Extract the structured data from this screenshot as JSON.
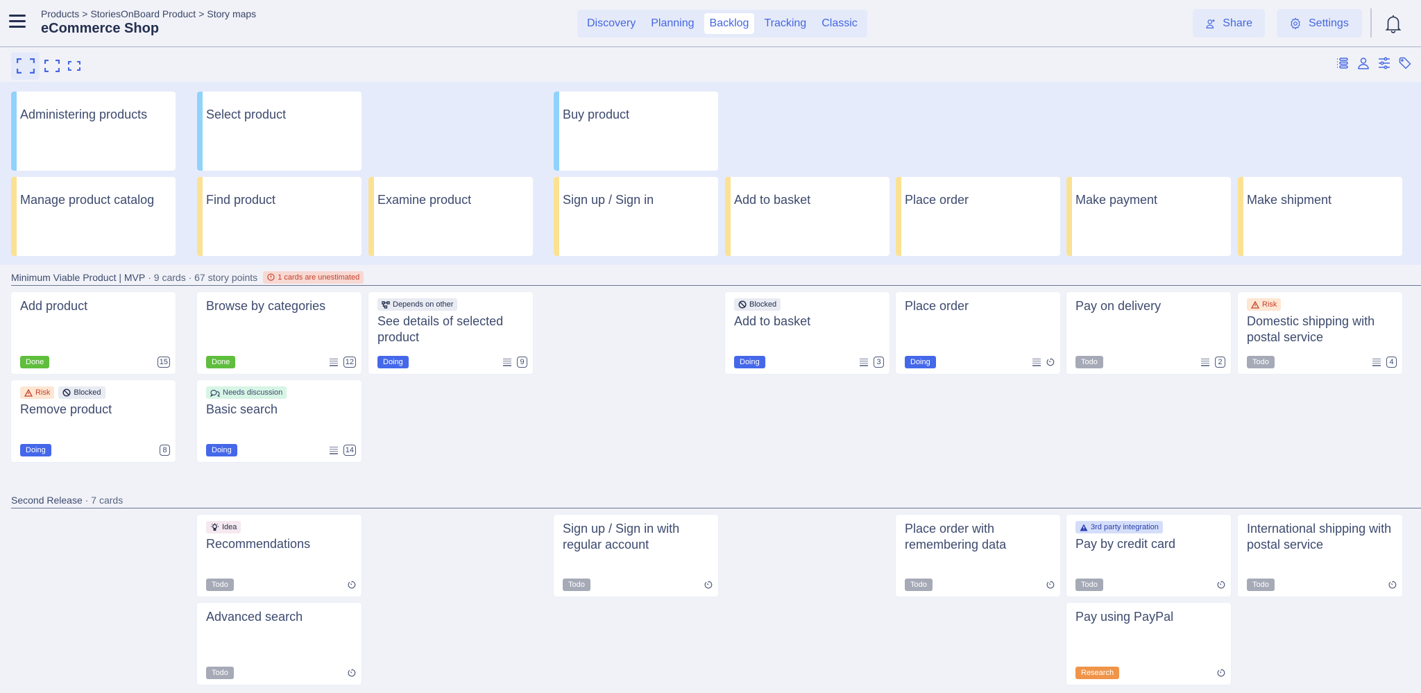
{
  "header": {
    "breadcrumb": [
      "Products",
      "StoriesOnBoard Product",
      "Story maps"
    ],
    "breadcrumb_separator": ">",
    "title": "eCommerce Shop",
    "view_tabs": [
      {
        "label": "Discovery",
        "active": false
      },
      {
        "label": "Planning",
        "active": false
      },
      {
        "label": "Backlog",
        "active": true
      },
      {
        "label": "Tracking",
        "active": false
      },
      {
        "label": "Classic",
        "active": false
      }
    ],
    "share_label": "Share",
    "settings_label": "Settings",
    "icons": {
      "menu": "hamburger-icon",
      "share": "user-plus-icon",
      "settings": "gear-icon",
      "notifications": "bell-icon"
    }
  },
  "toolbar": {
    "zoom_levels": [
      "large",
      "medium",
      "small"
    ],
    "active_zoom": "large",
    "right_icons": [
      "list-view-icon",
      "person-icon",
      "sliders-icon",
      "tag-icon"
    ]
  },
  "colors": {
    "accent": "#4467df",
    "activity_stripe": "#91d2fb",
    "step_stripe": "#fbe193",
    "status_done": "#5fbe3d",
    "status_doing": "#4568ea",
    "status_todo": "#a6aab7",
    "status_research": "#ef9448"
  },
  "activities": [
    {
      "title": "Administering products",
      "col": 0
    },
    {
      "title": "Select product",
      "col": 1
    },
    {
      "title": "Buy product",
      "col": 3
    }
  ],
  "steps": [
    {
      "title": "Manage product catalog",
      "col": 0
    },
    {
      "title": "Find product",
      "col": 1
    },
    {
      "title": "Examine product",
      "col": 2
    },
    {
      "title": "Sign up / Sign in",
      "col": 3
    },
    {
      "title": "Add to basket",
      "col": 4
    },
    {
      "title": "Place order",
      "col": 5
    },
    {
      "title": "Make payment",
      "col": 6
    },
    {
      "title": "Make shipment",
      "col": 7
    }
  ],
  "releases": [
    {
      "name": "Minimum Viable Product | MVP",
      "meta": "· 9 cards · 67 story points",
      "warning": "1 cards are unestimated",
      "cards": [
        {
          "title": "Add product",
          "col": 0,
          "row": 0,
          "tags": [],
          "status": "Done",
          "status_kind": "done",
          "has_description": false,
          "points": "15"
        },
        {
          "title": "Remove product",
          "col": 0,
          "row": 1,
          "tags": [
            {
              "label": "Risk",
              "kind": "risk"
            },
            {
              "label": "Blocked",
              "kind": "blocked"
            }
          ],
          "status": "Doing",
          "status_kind": "doing",
          "has_description": false,
          "points": "8"
        },
        {
          "title": "Browse by categories",
          "col": 1,
          "row": 0,
          "tags": [],
          "status": "Done",
          "status_kind": "done",
          "has_description": true,
          "points": "12"
        },
        {
          "title": "Basic search",
          "col": 1,
          "row": 1,
          "tags": [
            {
              "label": "Needs discussion",
              "kind": "disc"
            }
          ],
          "status": "Doing",
          "status_kind": "doing",
          "has_description": true,
          "points": "14"
        },
        {
          "title": "See details of selected product",
          "col": 2,
          "row": 0,
          "tags": [
            {
              "label": "Depends on other",
              "kind": "dep"
            }
          ],
          "status": "Doing",
          "status_kind": "doing",
          "has_description": true,
          "points": "9"
        },
        {
          "title": "Add to basket",
          "col": 4,
          "row": 0,
          "tags": [
            {
              "label": "Blocked",
              "kind": "blocked"
            }
          ],
          "status": "Doing",
          "status_kind": "doing",
          "has_description": true,
          "points": "3"
        },
        {
          "title": "Place order",
          "col": 5,
          "row": 0,
          "tags": [],
          "status": "Doing",
          "status_kind": "doing",
          "has_description": true,
          "points": null
        },
        {
          "title": "Pay on delivery",
          "col": 6,
          "row": 0,
          "tags": [],
          "status": "Todo",
          "status_kind": "todo",
          "has_description": true,
          "points": "2"
        },
        {
          "title": "Domestic shipping with postal service",
          "col": 7,
          "row": 0,
          "tags": [
            {
              "label": "Risk",
              "kind": "risk"
            }
          ],
          "status": "Todo",
          "status_kind": "todo",
          "has_description": true,
          "points": "4"
        }
      ]
    },
    {
      "name": "Second Release",
      "meta": "· 7 cards",
      "warning": null,
      "cards": [
        {
          "title": "Recommendations",
          "col": 1,
          "row": 0,
          "tags": [
            {
              "label": "Idea",
              "kind": "idea"
            }
          ],
          "status": "Todo",
          "status_kind": "todo",
          "has_description": false,
          "points": null
        },
        {
          "title": "Advanced search",
          "col": 1,
          "row": 1,
          "tags": [],
          "status": "Todo",
          "status_kind": "todo",
          "has_description": false,
          "points": null
        },
        {
          "title": "Sign up / Sign in with regular account",
          "col": 3,
          "row": 0,
          "tags": [],
          "status": "Todo",
          "status_kind": "todo",
          "has_description": false,
          "points": null
        },
        {
          "title": "Place order with remembering data",
          "col": 5,
          "row": 0,
          "tags": [],
          "status": "Todo",
          "status_kind": "todo",
          "has_description": false,
          "points": null
        },
        {
          "title": "Pay by credit card",
          "col": 6,
          "row": 0,
          "tags": [
            {
              "label": "3rd party integration",
              "kind": "third"
            }
          ],
          "status": "Todo",
          "status_kind": "todo",
          "has_description": false,
          "points": null
        },
        {
          "title": "Pay using PayPal",
          "col": 6,
          "row": 1,
          "tags": [],
          "status": "Research",
          "status_kind": "research",
          "has_description": false,
          "points": null
        },
        {
          "title": "International shipping with postal service",
          "col": 7,
          "row": 0,
          "tags": [],
          "status": "Todo",
          "status_kind": "todo",
          "has_description": false,
          "points": null
        }
      ]
    }
  ]
}
